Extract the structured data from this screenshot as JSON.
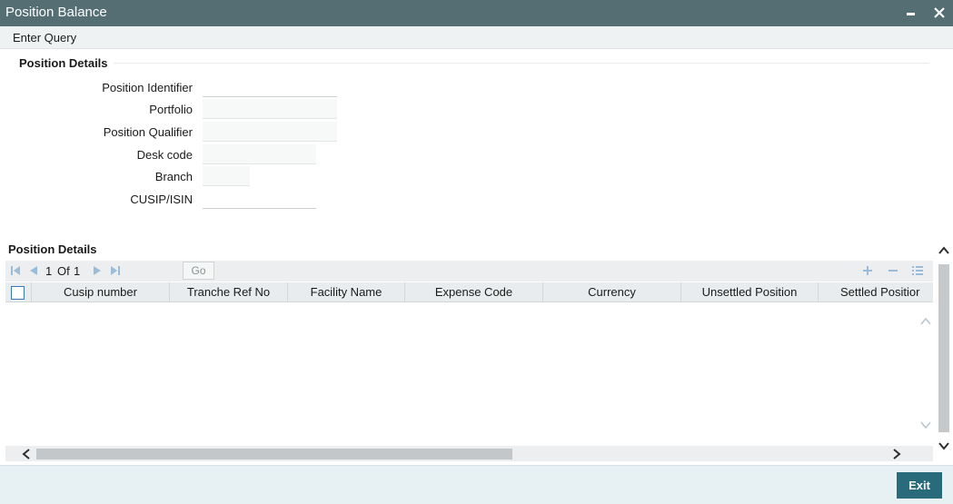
{
  "window": {
    "title": "Position Balance",
    "minimize_icon": "minimize-icon",
    "close_icon": "close-icon"
  },
  "menu": {
    "enter_query": "Enter Query"
  },
  "position_details": {
    "section_title": "Position Details",
    "fields": {
      "position_identifier": {
        "label": "Position Identifier",
        "value": ""
      },
      "portfolio": {
        "label": "Portfolio",
        "value": ""
      },
      "position_qualifier": {
        "label": "Position Qualifier",
        "value": ""
      },
      "desk_code": {
        "label": "Desk code",
        "value": ""
      },
      "branch": {
        "label": "Branch",
        "value": ""
      },
      "cusip_isin": {
        "label": "CUSIP/ISIN",
        "value": ""
      }
    }
  },
  "grid": {
    "section_title": "Position Details",
    "pagination": {
      "current": "1",
      "of_label": "Of",
      "total": "1",
      "page_input": ""
    },
    "go_label": "Go",
    "columns": [
      "Cusip number",
      "Tranche Ref No",
      "Facility Name",
      "Expense Code",
      "Currency",
      "Unsettled Position",
      "Settled Positior"
    ],
    "rows": []
  },
  "footer": {
    "exit_label": "Exit"
  },
  "colors": {
    "titlebar": "#546e74",
    "accent": "#2a6b7b",
    "checkbox_border": "#3b78b6"
  }
}
